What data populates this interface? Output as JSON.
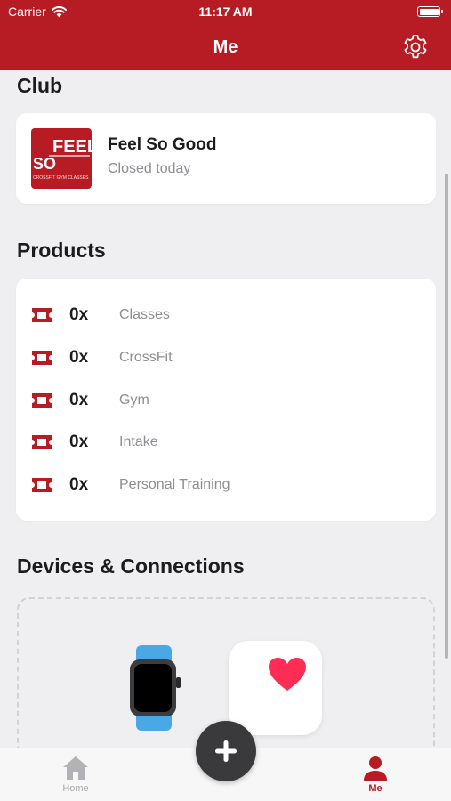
{
  "status_bar": {
    "carrier": "Carrier",
    "time": "11:17 AM"
  },
  "nav": {
    "title": "Me"
  },
  "club": {
    "section_title": "Club",
    "name": "Feel So Good",
    "status": "Closed today",
    "logo_text": "FEEL SO",
    "logo_subtext": "CROSSFIT GYM CLASSES"
  },
  "products": {
    "section_title": "Products",
    "items": [
      {
        "count": "0x",
        "name": "Classes"
      },
      {
        "count": "0x",
        "name": "CrossFit"
      },
      {
        "count": "0x",
        "name": "Gym"
      },
      {
        "count": "0x",
        "name": "Intake"
      },
      {
        "count": "0x",
        "name": "Personal Training"
      }
    ]
  },
  "devices": {
    "section_title": "Devices & Connections"
  },
  "tabbar": {
    "home_label": "Home",
    "me_label": "Me"
  },
  "colors": {
    "brand": "#b71c24",
    "fab": "#3a3a3c",
    "heart": "#ff2d55",
    "watch_band": "#4aa8e6"
  }
}
